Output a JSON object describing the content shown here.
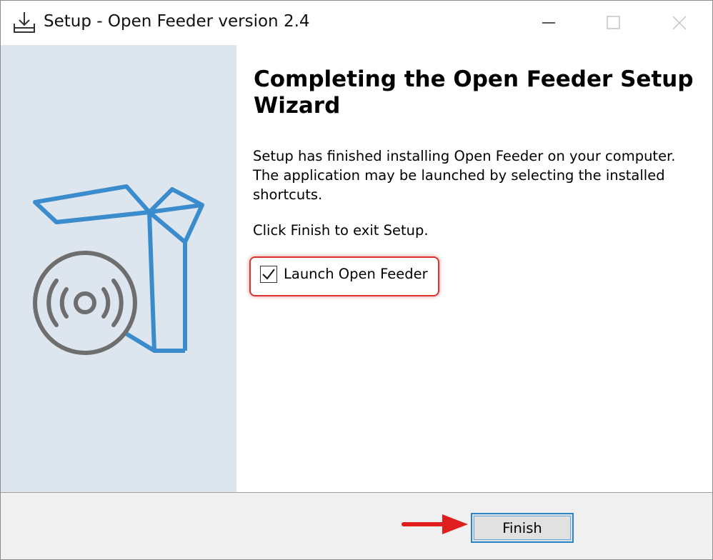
{
  "window": {
    "title": "Setup - Open Feeder version 2.4",
    "icons": {
      "app": "download-tray-icon",
      "minimize": "minimize-icon",
      "maximize": "maximize-icon",
      "close": "close-icon"
    }
  },
  "sidebar": {
    "image": "software-box-with-disc-icon"
  },
  "main": {
    "heading": "Completing the Open Feeder Setup Wizard",
    "description": "Setup has finished installing Open Feeder on your computer. The application may be launched by selecting the installed shortcuts.",
    "exit_instruction": "Click Finish to exit Setup.",
    "launch_checkbox": {
      "label": "Launch Open Feeder",
      "checked": true
    }
  },
  "footer": {
    "finish_label": "Finish"
  },
  "colors": {
    "sidebar_bg": "#dde6ee",
    "box_outline": "#3a8ccc",
    "disc": "#6e6e6e",
    "highlight": "#d93434",
    "focus_border": "#2b86c8"
  }
}
